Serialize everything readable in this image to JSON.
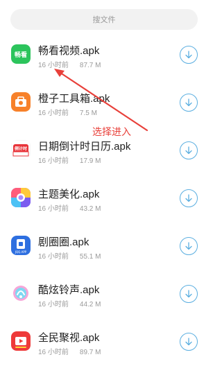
{
  "search": {
    "placeholder": "搜文件"
  },
  "files": [
    {
      "name": "畅看视频.apk",
      "time": "16 小时前",
      "size": "87.7 M",
      "icon": "changkan-app-icon",
      "icon_text": "畅看",
      "color": "#2cc45c"
    },
    {
      "name": "橙子工具箱.apk",
      "time": "16 小时前",
      "size": "7.5 M",
      "icon": "orange-toolbox-app-icon",
      "color": "#f7812a"
    },
    {
      "name": "日期倒计时日历.apk",
      "time": "16 小时前",
      "size": "17.9 M",
      "icon": "countdown-calendar-app-icon",
      "icon_text": "倒计时",
      "color": "#e8343a"
    },
    {
      "name": "主题美化.apk",
      "time": "16 小时前",
      "size": "43.2 M",
      "icon": "theme-app-icon",
      "color": "#7b5cf0"
    },
    {
      "name": "剧圈圈.apk",
      "time": "16 小时前",
      "size": "55.1 M",
      "icon": "juquanquan-app-icon",
      "icon_text": "JQQ.APP",
      "color": "#2e6fe0"
    },
    {
      "name": "酷炫铃声.apk",
      "time": "16 小时前",
      "size": "44.2 M",
      "icon": "ringtone-app-icon",
      "color": "#56c7e8"
    },
    {
      "name": "全民聚视.apk",
      "time": "16 小时前",
      "size": "89.7 M",
      "icon": "quanmin-app-icon",
      "color": "#ee3a3a"
    }
  ],
  "annotation": {
    "label": "选择进入",
    "color": "#e8403a"
  },
  "colors": {
    "download_ring": "#5aaee0"
  }
}
